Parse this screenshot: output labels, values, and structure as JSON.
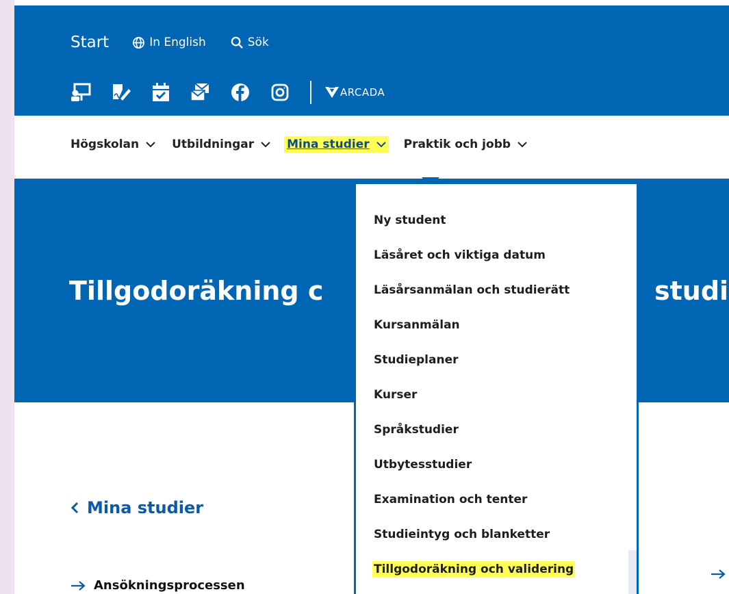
{
  "header": {
    "start": "Start",
    "language": "In English",
    "search": "Sök",
    "logo_text": "ARCADA",
    "quick_icons": [
      "presentation-icon",
      "edit-document-icon",
      "calendar-icon",
      "mail-icon",
      "facebook-icon",
      "instagram-icon"
    ]
  },
  "nav": {
    "items": [
      {
        "label": "Högskolan"
      },
      {
        "label": "Utbildningar"
      },
      {
        "label": "Mina studier"
      },
      {
        "label": "Praktik och jobb"
      }
    ],
    "active_index": 2
  },
  "hero": {
    "title_left": "Tillgodoräkning",
    "title_cut": "c",
    "title_right": "studi"
  },
  "dropdown": {
    "items": [
      {
        "label": "Ny student"
      },
      {
        "label": "Läsåret och viktiga datum"
      },
      {
        "label": "Läsårsanmälan och studierätt"
      },
      {
        "label": "Kursanmälan"
      },
      {
        "label": "Studieplaner"
      },
      {
        "label": "Kurser"
      },
      {
        "label": "Språkstudier"
      },
      {
        "label": "Utbytesstudier"
      },
      {
        "label": "Examination och tenter"
      },
      {
        "label": "Studieintyg och blanketter"
      },
      {
        "label": "Tillgodoräkning och validering"
      }
    ],
    "highlighted_index": 10
  },
  "content": {
    "back_link": "Mina studier",
    "side_link": "Ansökningsprocessen"
  },
  "colors": {
    "brand_blue": "#0066b3",
    "highlight": "#ffff55",
    "background": "#ece3ee"
  }
}
